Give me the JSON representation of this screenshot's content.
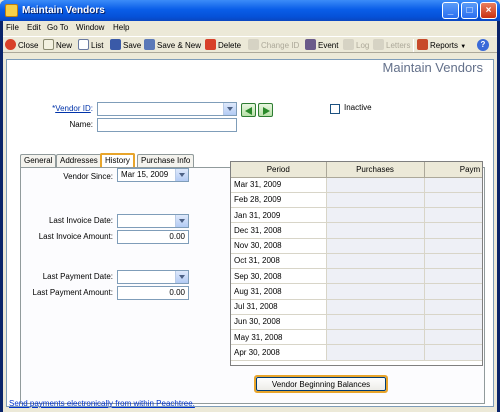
{
  "window": {
    "title": "Maintain Vendors",
    "minimize": "_",
    "maximize": "□",
    "close": "×"
  },
  "menu": [
    "File",
    "Edit",
    "Go To",
    "Window",
    "Help"
  ],
  "toolbar": {
    "close": "Close",
    "new": "New",
    "list": "List",
    "save": "Save",
    "save_new": "Save & New",
    "delete": "Delete",
    "change_id": "Change ID",
    "event": "Event",
    "log": "Log",
    "letters": "Letters",
    "reports": "Reports",
    "help_glyph": "?"
  },
  "page_title": "Maintain Vendors",
  "vendor": {
    "id_label_prefix": "*",
    "id_label": "Vendor ID",
    "id_label_suffix": ":",
    "id_value": "",
    "name_label": "Name:",
    "name_value": "",
    "inactive_label": "Inactive",
    "inactive_checked": false
  },
  "tabs": [
    {
      "label": "General",
      "active": false
    },
    {
      "label": "Addresses",
      "active": false
    },
    {
      "label": "History",
      "active": true
    },
    {
      "label": "Purchase Info",
      "active": false
    }
  ],
  "history": {
    "vendor_since_label": "Vendor Since:",
    "vendor_since_value": "Mar 15, 2009",
    "last_invoice_date_label": "Last Invoice Date:",
    "last_invoice_date_value": "",
    "last_invoice_amount_label": "Last Invoice Amount:",
    "last_invoice_amount_value": "0.00",
    "last_payment_date_label": "Last Payment Date:",
    "last_payment_date_value": "",
    "last_payment_amount_label": "Last Payment Amount:",
    "last_payment_amount_value": "0.00"
  },
  "grid": {
    "columns": [
      "Period",
      "Purchases",
      "Paym"
    ],
    "rows": [
      "Mar 31, 2009",
      "Feb 28, 2009",
      "Jan 31, 2009",
      "Dec 31, 2008",
      "Nov 30, 2008",
      "Oct 31, 2008",
      "Sep 30, 2008",
      "Aug 31, 2008",
      "Jul 31, 2008",
      "Jun 30, 2008",
      "May 31, 2008",
      "Apr 30, 2008"
    ]
  },
  "beginning_balances_button": "Vendor Beginning Balances",
  "status_link": "Send payments electronically from within Peachtree.",
  "colors": {
    "highlight": "#e8a52c",
    "title_bar": "#0a5ee8",
    "link": "#0033cc"
  }
}
